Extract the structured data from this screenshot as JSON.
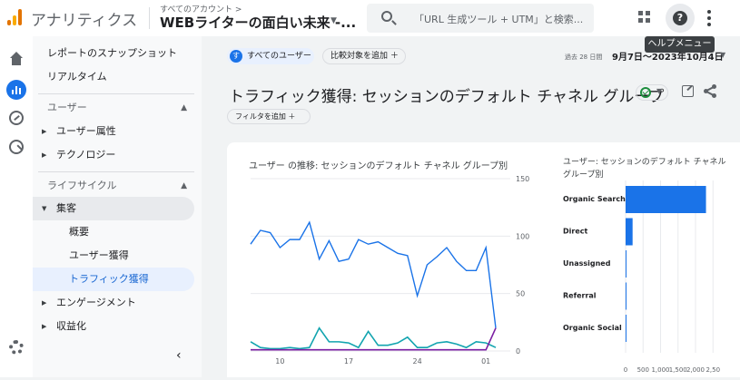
{
  "header": {
    "app_name": "アナリティクス",
    "account_breadcrumb": "すべてのアカウント >",
    "property_name": "WEBライターの面白い未来 -...",
    "search_placeholder": "「URL 生成ツール + UTM」と検索...",
    "help_tooltip": "ヘルプメニュー"
  },
  "sidebar": {
    "items": [
      {
        "label": "レポートのスナップショット"
      },
      {
        "label": "リアルタイム"
      },
      {
        "label": "ユーザー"
      },
      {
        "label": "ユーザー属性"
      },
      {
        "label": "テクノロジー"
      },
      {
        "label": "ライフサイクル"
      },
      {
        "label": "集客"
      },
      {
        "label": "概要"
      },
      {
        "label": "ユーザー獲得"
      },
      {
        "label": "トラフィック獲得"
      },
      {
        "label": "エンゲージメント"
      },
      {
        "label": "収益化"
      }
    ],
    "collapse_glyph": "‹"
  },
  "toolbar": {
    "user_badge": "す",
    "user_segment": "すべてのユーザー",
    "add_comparison": "比較対象を追加 ＋",
    "date_range_label": "過去 28 日間",
    "date_range_value": "9月7日～2023年10月4日"
  },
  "page": {
    "title": "トラフィック獲得: セッションのデフォルト チャネル グループ",
    "add_filter": "フィルタを追加 ＋"
  },
  "colors": {
    "accent": "#1a73e8",
    "series_organic": "#1a73e8",
    "series_direct": "#12a4af",
    "series_other": "#7b1fa2"
  },
  "chart_data": [
    {
      "type": "line",
      "title": "ユーザー の推移: セッションのデフォルト チャネル グループ別",
      "ylim": [
        0,
        150
      ],
      "yticks": [
        "0",
        "50",
        "100",
        "150"
      ],
      "xticks": [
        "10",
        "17",
        "24",
        "01"
      ],
      "xtick_positions": [
        3,
        10,
        17,
        24
      ],
      "series": [
        {
          "values": [
            93,
            105,
            103,
            90,
            97,
            97,
            112,
            80,
            96,
            78,
            80,
            97,
            93,
            95,
            90,
            85,
            83,
            48,
            75,
            82,
            90,
            78,
            70,
            70,
            90,
            20
          ]
        },
        {
          "values": [
            8,
            3,
            2,
            2,
            3,
            2,
            3,
            20,
            8,
            8,
            7,
            3,
            17,
            5,
            5,
            7,
            12,
            3,
            3,
            7,
            8,
            6,
            3,
            8,
            7,
            3
          ]
        },
        {
          "values": [
            1,
            1,
            1,
            1,
            1,
            1,
            1,
            1,
            1,
            1,
            1,
            1,
            1,
            1,
            1,
            1,
            1,
            1,
            1,
            1,
            1,
            1,
            1,
            1,
            1,
            20
          ]
        }
      ]
    },
    {
      "type": "bar",
      "title": "ユーザー: セッションのデフォルト チャネル グループ別",
      "categories": [
        "Organic Search",
        "Direct",
        "Unassigned",
        "Referral",
        "Organic Social"
      ],
      "values": [
        2300,
        200,
        20,
        3,
        2
      ],
      "xticks": [
        "0",
        "500",
        "1,000",
        "1,500",
        "2,000",
        "2,50"
      ]
    }
  ]
}
